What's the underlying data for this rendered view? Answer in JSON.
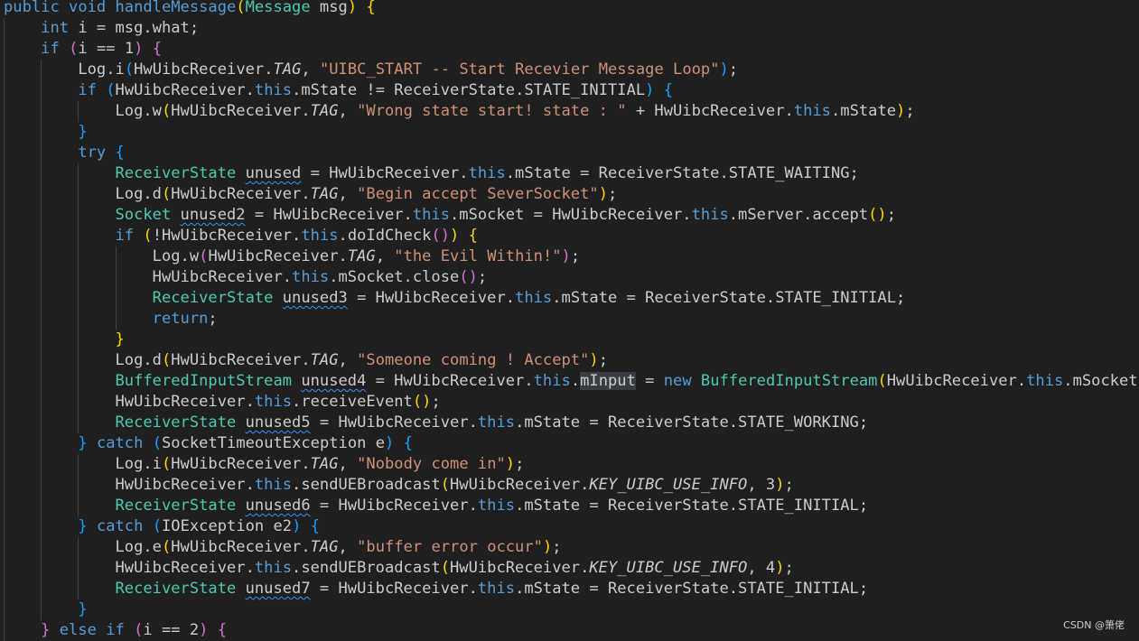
{
  "watermark": "CSDN @箫佬",
  "lines": [
    {
      "indent": 0,
      "tokens": [
        {
          "t": "public void handleMessage",
          "c": "kw1"
        },
        {
          "t": "(",
          "c": "b1"
        },
        {
          "t": "Message",
          "c": "cls"
        },
        {
          "t": " msg",
          "c": ""
        },
        {
          "t": ")",
          "c": "b1"
        },
        {
          "t": " ",
          "c": ""
        },
        {
          "t": "{",
          "c": "b1"
        }
      ]
    },
    {
      "indent": 1,
      "tokens": [
        {
          "t": "int",
          "c": "kw"
        },
        {
          "t": " i = msg.what;",
          "c": ""
        }
      ]
    },
    {
      "indent": 1,
      "tokens": [
        {
          "t": "if",
          "c": "kw"
        },
        {
          "t": " ",
          "c": ""
        },
        {
          "t": "(",
          "c": "b2"
        },
        {
          "t": "i == 1",
          "c": ""
        },
        {
          "t": ")",
          "c": "b2"
        },
        {
          "t": " ",
          "c": ""
        },
        {
          "t": "{",
          "c": "b2"
        }
      ]
    },
    {
      "indent": 2,
      "tokens": [
        {
          "t": "Log.i",
          "c": ""
        },
        {
          "t": "(",
          "c": "b3"
        },
        {
          "t": "HwUibcReceiver.",
          "c": ""
        },
        {
          "t": "TAG",
          "c": "it"
        },
        {
          "t": ", ",
          "c": ""
        },
        {
          "t": "\"UIBC_START -- Start Recevier Message Loop\"",
          "c": "str"
        },
        {
          "t": ")",
          "c": "b3"
        },
        {
          "t": ";",
          "c": ""
        }
      ]
    },
    {
      "indent": 2,
      "tokens": [
        {
          "t": "if",
          "c": "kw"
        },
        {
          "t": " ",
          "c": ""
        },
        {
          "t": "(",
          "c": "b3"
        },
        {
          "t": "HwUibcReceiver.",
          "c": ""
        },
        {
          "t": "this",
          "c": "kw"
        },
        {
          "t": ".mState != ReceiverState.STATE_INITIAL",
          "c": ""
        },
        {
          "t": ")",
          "c": "b3"
        },
        {
          "t": " ",
          "c": ""
        },
        {
          "t": "{",
          "c": "b3"
        }
      ]
    },
    {
      "indent": 3,
      "tokens": [
        {
          "t": "Log.w",
          "c": ""
        },
        {
          "t": "(",
          "c": "b1"
        },
        {
          "t": "HwUibcReceiver.",
          "c": ""
        },
        {
          "t": "TAG",
          "c": "it"
        },
        {
          "t": ", ",
          "c": ""
        },
        {
          "t": "\"Wrong state start! state : \"",
          "c": "str"
        },
        {
          "t": " + HwUibcReceiver.",
          "c": ""
        },
        {
          "t": "this",
          "c": "kw"
        },
        {
          "t": ".mState",
          "c": ""
        },
        {
          "t": ")",
          "c": "b1"
        },
        {
          "t": ";",
          "c": ""
        }
      ]
    },
    {
      "indent": 2,
      "tokens": [
        {
          "t": "}",
          "c": "b3"
        }
      ]
    },
    {
      "indent": 2,
      "tokens": [
        {
          "t": "try",
          "c": "kw"
        },
        {
          "t": " ",
          "c": ""
        },
        {
          "t": "{",
          "c": "b3"
        }
      ]
    },
    {
      "indent": 3,
      "tokens": [
        {
          "t": "ReceiverState",
          "c": "cls"
        },
        {
          "t": " ",
          "c": ""
        },
        {
          "t": "unused",
          "c": "unused"
        },
        {
          "t": " = HwUibcReceiver.",
          "c": ""
        },
        {
          "t": "this",
          "c": "kw"
        },
        {
          "t": ".mState = ReceiverState.STATE_WAITING;",
          "c": ""
        }
      ]
    },
    {
      "indent": 3,
      "tokens": [
        {
          "t": "Log.d",
          "c": ""
        },
        {
          "t": "(",
          "c": "b1"
        },
        {
          "t": "HwUibcReceiver.",
          "c": ""
        },
        {
          "t": "TAG",
          "c": "it"
        },
        {
          "t": ", ",
          "c": ""
        },
        {
          "t": "\"Begin accept SeverSocket\"",
          "c": "str"
        },
        {
          "t": ")",
          "c": "b1"
        },
        {
          "t": ";",
          "c": ""
        }
      ]
    },
    {
      "indent": 3,
      "tokens": [
        {
          "t": "Socket",
          "c": "cls"
        },
        {
          "t": " ",
          "c": ""
        },
        {
          "t": "unused2",
          "c": "unused"
        },
        {
          "t": " = HwUibcReceiver.",
          "c": ""
        },
        {
          "t": "this",
          "c": "kw"
        },
        {
          "t": ".mSocket = HwUibcReceiver.",
          "c": ""
        },
        {
          "t": "this",
          "c": "kw"
        },
        {
          "t": ".mServer.accept",
          "c": ""
        },
        {
          "t": "()",
          "c": "b1"
        },
        {
          "t": ";",
          "c": ""
        }
      ]
    },
    {
      "indent": 3,
      "tokens": [
        {
          "t": "if",
          "c": "kw"
        },
        {
          "t": " ",
          "c": ""
        },
        {
          "t": "(",
          "c": "b1"
        },
        {
          "t": "!HwUibcReceiver.",
          "c": ""
        },
        {
          "t": "this",
          "c": "kw"
        },
        {
          "t": ".doIdCheck",
          "c": ""
        },
        {
          "t": "()",
          "c": "b2"
        },
        {
          "t": ")",
          "c": "b1"
        },
        {
          "t": " ",
          "c": ""
        },
        {
          "t": "{",
          "c": "b1"
        }
      ]
    },
    {
      "indent": 4,
      "tokens": [
        {
          "t": "Log.w",
          "c": ""
        },
        {
          "t": "(",
          "c": "b2"
        },
        {
          "t": "HwUibcReceiver.",
          "c": ""
        },
        {
          "t": "TAG",
          "c": "it"
        },
        {
          "t": ", ",
          "c": ""
        },
        {
          "t": "\"the Evil Within!\"",
          "c": "str"
        },
        {
          "t": ")",
          "c": "b2"
        },
        {
          "t": ";",
          "c": ""
        }
      ]
    },
    {
      "indent": 4,
      "tokens": [
        {
          "t": "HwUibcReceiver.",
          "c": ""
        },
        {
          "t": "this",
          "c": "kw"
        },
        {
          "t": ".mSocket.close",
          "c": ""
        },
        {
          "t": "()",
          "c": "b2"
        },
        {
          "t": ";",
          "c": ""
        }
      ]
    },
    {
      "indent": 4,
      "tokens": [
        {
          "t": "ReceiverState",
          "c": "cls"
        },
        {
          "t": " ",
          "c": ""
        },
        {
          "t": "unused3",
          "c": "unused"
        },
        {
          "t": " = HwUibcReceiver.",
          "c": ""
        },
        {
          "t": "this",
          "c": "kw"
        },
        {
          "t": ".mState = ReceiverState.STATE_INITIAL;",
          "c": ""
        }
      ]
    },
    {
      "indent": 4,
      "tokens": [
        {
          "t": "return",
          "c": "kw"
        },
        {
          "t": ";",
          "c": ""
        }
      ]
    },
    {
      "indent": 3,
      "tokens": [
        {
          "t": "}",
          "c": "b1"
        }
      ]
    },
    {
      "indent": 3,
      "tokens": [
        {
          "t": "Log.d",
          "c": ""
        },
        {
          "t": "(",
          "c": "b1"
        },
        {
          "t": "HwUibcReceiver.",
          "c": ""
        },
        {
          "t": "TAG",
          "c": "it"
        },
        {
          "t": ", ",
          "c": ""
        },
        {
          "t": "\"Someone coming ! Accept\"",
          "c": "str"
        },
        {
          "t": ")",
          "c": "b1"
        },
        {
          "t": ";",
          "c": ""
        }
      ]
    },
    {
      "indent": 3,
      "tokens": [
        {
          "t": "BufferedInputStream",
          "c": "cls"
        },
        {
          "t": " ",
          "c": ""
        },
        {
          "t": "unused4",
          "c": "unused"
        },
        {
          "t": " = HwUibcReceiver.",
          "c": ""
        },
        {
          "t": "this",
          "c": "kw"
        },
        {
          "t": ".",
          "c": ""
        },
        {
          "t": "mInput",
          "c": "hl"
        },
        {
          "t": " = ",
          "c": ""
        },
        {
          "t": "new",
          "c": "kw"
        },
        {
          "t": " ",
          "c": ""
        },
        {
          "t": "BufferedInputStream",
          "c": "cls"
        },
        {
          "t": "(",
          "c": "b1"
        },
        {
          "t": "HwUibcReceiver.",
          "c": ""
        },
        {
          "t": "this",
          "c": "kw"
        },
        {
          "t": ".mSocket.",
          "c": ""
        }
      ]
    },
    {
      "indent": 3,
      "tokens": [
        {
          "t": "HwUibcReceiver.",
          "c": ""
        },
        {
          "t": "this",
          "c": "kw"
        },
        {
          "t": ".receiveEvent",
          "c": ""
        },
        {
          "t": "()",
          "c": "b1"
        },
        {
          "t": ";",
          "c": ""
        }
      ]
    },
    {
      "indent": 3,
      "tokens": [
        {
          "t": "ReceiverState",
          "c": "cls"
        },
        {
          "t": " ",
          "c": ""
        },
        {
          "t": "unused5",
          "c": "unused"
        },
        {
          "t": " = HwUibcReceiver.",
          "c": ""
        },
        {
          "t": "this",
          "c": "kw"
        },
        {
          "t": ".mState = ReceiverState.STATE_WORKING;",
          "c": ""
        }
      ]
    },
    {
      "indent": 2,
      "tokens": [
        {
          "t": "}",
          "c": "b3"
        },
        {
          "t": " ",
          "c": ""
        },
        {
          "t": "catch",
          "c": "kw"
        },
        {
          "t": " ",
          "c": ""
        },
        {
          "t": "(",
          "c": "b3"
        },
        {
          "t": "SocketTimeoutException",
          "c": ""
        },
        {
          "t": " e",
          "c": ""
        },
        {
          "t": ")",
          "c": "b3"
        },
        {
          "t": " ",
          "c": ""
        },
        {
          "t": "{",
          "c": "b3"
        }
      ]
    },
    {
      "indent": 3,
      "tokens": [
        {
          "t": "Log.i",
          "c": ""
        },
        {
          "t": "(",
          "c": "b1"
        },
        {
          "t": "HwUibcReceiver.",
          "c": ""
        },
        {
          "t": "TAG",
          "c": "it"
        },
        {
          "t": ", ",
          "c": ""
        },
        {
          "t": "\"Nobody come in\"",
          "c": "str"
        },
        {
          "t": ")",
          "c": "b1"
        },
        {
          "t": ";",
          "c": ""
        }
      ]
    },
    {
      "indent": 3,
      "tokens": [
        {
          "t": "HwUibcReceiver.",
          "c": ""
        },
        {
          "t": "this",
          "c": "kw"
        },
        {
          "t": ".sendUEBroadcast",
          "c": ""
        },
        {
          "t": "(",
          "c": "b1"
        },
        {
          "t": "HwUibcReceiver.",
          "c": ""
        },
        {
          "t": "KEY_UIBC_USE_INFO",
          "c": "it"
        },
        {
          "t": ", 3",
          "c": ""
        },
        {
          "t": ")",
          "c": "b1"
        },
        {
          "t": ";",
          "c": ""
        }
      ]
    },
    {
      "indent": 3,
      "tokens": [
        {
          "t": "ReceiverState",
          "c": "cls"
        },
        {
          "t": " ",
          "c": ""
        },
        {
          "t": "unused6",
          "c": "unused"
        },
        {
          "t": " = HwUibcReceiver.",
          "c": ""
        },
        {
          "t": "this",
          "c": "kw"
        },
        {
          "t": ".mState = ReceiverState.STATE_INITIAL;",
          "c": ""
        }
      ]
    },
    {
      "indent": 2,
      "tokens": [
        {
          "t": "}",
          "c": "b3"
        },
        {
          "t": " ",
          "c": ""
        },
        {
          "t": "catch",
          "c": "kw"
        },
        {
          "t": " ",
          "c": ""
        },
        {
          "t": "(",
          "c": "b3"
        },
        {
          "t": "IOException",
          "c": ""
        },
        {
          "t": " e2",
          "c": ""
        },
        {
          "t": ")",
          "c": "b3"
        },
        {
          "t": " ",
          "c": ""
        },
        {
          "t": "{",
          "c": "b3"
        }
      ]
    },
    {
      "indent": 3,
      "tokens": [
        {
          "t": "Log.e",
          "c": ""
        },
        {
          "t": "(",
          "c": "b1"
        },
        {
          "t": "HwUibcReceiver.",
          "c": ""
        },
        {
          "t": "TAG",
          "c": "it"
        },
        {
          "t": ", ",
          "c": ""
        },
        {
          "t": "\"buffer error occur\"",
          "c": "str"
        },
        {
          "t": ")",
          "c": "b1"
        },
        {
          "t": ";",
          "c": ""
        }
      ]
    },
    {
      "indent": 3,
      "tokens": [
        {
          "t": "HwUibcReceiver.",
          "c": ""
        },
        {
          "t": "this",
          "c": "kw"
        },
        {
          "t": ".sendUEBroadcast",
          "c": ""
        },
        {
          "t": "(",
          "c": "b1"
        },
        {
          "t": "HwUibcReceiver.",
          "c": ""
        },
        {
          "t": "KEY_UIBC_USE_INFO",
          "c": "it"
        },
        {
          "t": ", 4",
          "c": ""
        },
        {
          "t": ")",
          "c": "b1"
        },
        {
          "t": ";",
          "c": ""
        }
      ]
    },
    {
      "indent": 3,
      "tokens": [
        {
          "t": "ReceiverState",
          "c": "cls"
        },
        {
          "t": " ",
          "c": ""
        },
        {
          "t": "unused7",
          "c": "unused"
        },
        {
          "t": " = HwUibcReceiver.",
          "c": ""
        },
        {
          "t": "this",
          "c": "kw"
        },
        {
          "t": ".mState = ReceiverState.STATE_INITIAL;",
          "c": ""
        }
      ]
    },
    {
      "indent": 2,
      "tokens": [
        {
          "t": "}",
          "c": "b3"
        }
      ]
    },
    {
      "indent": 1,
      "tokens": [
        {
          "t": "}",
          "c": "b2"
        },
        {
          "t": " ",
          "c": ""
        },
        {
          "t": "else if",
          "c": "kw"
        },
        {
          "t": " ",
          "c": ""
        },
        {
          "t": "(",
          "c": "b2"
        },
        {
          "t": "i == 2",
          "c": ""
        },
        {
          "t": ")",
          "c": "b2"
        },
        {
          "t": " ",
          "c": ""
        },
        {
          "t": "{",
          "c": "b2"
        }
      ]
    }
  ]
}
